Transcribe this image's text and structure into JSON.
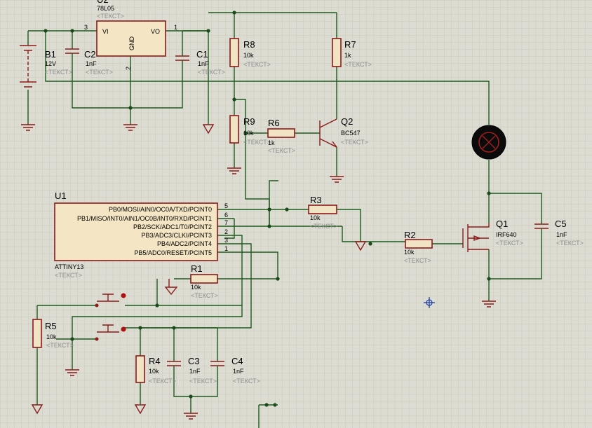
{
  "schematic": {
    "accent_color": "#8b1a1a",
    "wire_color": "#1c5a1c",
    "grid_color": "#c2c2b4",
    "background": "#dcdcd2",
    "placeholder_text": "<ТЕКСТ>",
    "regulator": {
      "ref": "U2",
      "value": "78L05",
      "pin_vi": "VI",
      "pin_vo": "VO",
      "pin_gnd": "GND",
      "pin_num_in": "3",
      "pin_num_out": "1",
      "pin_num_gnd": "2"
    },
    "mcu": {
      "ref": "U1",
      "part": "ATTINY13",
      "pins": [
        {
          "label": "PB0/MOSI/AIN0/OC0A/TXD/PCINT0",
          "num": "5"
        },
        {
          "label": "PB1/MISO/INT0/AIN1/OC0B/INT0/RXD/PCINT1",
          "num": "6"
        },
        {
          "label": "PB2/SCK/ADC1/T0/PCINT2",
          "num": "7"
        },
        {
          "label": "PB3/ADC3/CLKI/PCINT3",
          "num": "2"
        },
        {
          "label": "PB4/ADC2/PCINT4",
          "num": "3"
        },
        {
          "label": "PB5/ADC0/RESET/PCINT5",
          "num": "1"
        }
      ]
    },
    "battery": {
      "ref": "B1",
      "value": "12V"
    },
    "capacitors": {
      "C1": {
        "ref": "C1",
        "value": "1nF"
      },
      "C2": {
        "ref": "C2",
        "value": "1nF"
      },
      "C3": {
        "ref": "C3",
        "value": "1nF"
      },
      "C4": {
        "ref": "C4",
        "value": "1nF"
      },
      "C5": {
        "ref": "C5",
        "value": "1nF"
      }
    },
    "resistors": {
      "R1": {
        "ref": "R1",
        "value": "10k"
      },
      "R2": {
        "ref": "R2",
        "value": "10k"
      },
      "R3": {
        "ref": "R3",
        "value": "10k"
      },
      "R4": {
        "ref": "R4",
        "value": "10k"
      },
      "R5": {
        "ref": "R5",
        "value": "10k"
      },
      "R6": {
        "ref": "R6",
        "value": "1k"
      },
      "R7": {
        "ref": "R7",
        "value": "1k"
      },
      "R8": {
        "ref": "R8",
        "value": "10k"
      },
      "R9": {
        "ref": "R9",
        "value": "10k"
      }
    },
    "transistors": {
      "Q1": {
        "ref": "Q1",
        "value": "IRF640"
      },
      "Q2": {
        "ref": "Q2",
        "value": "BC547"
      }
    }
  }
}
